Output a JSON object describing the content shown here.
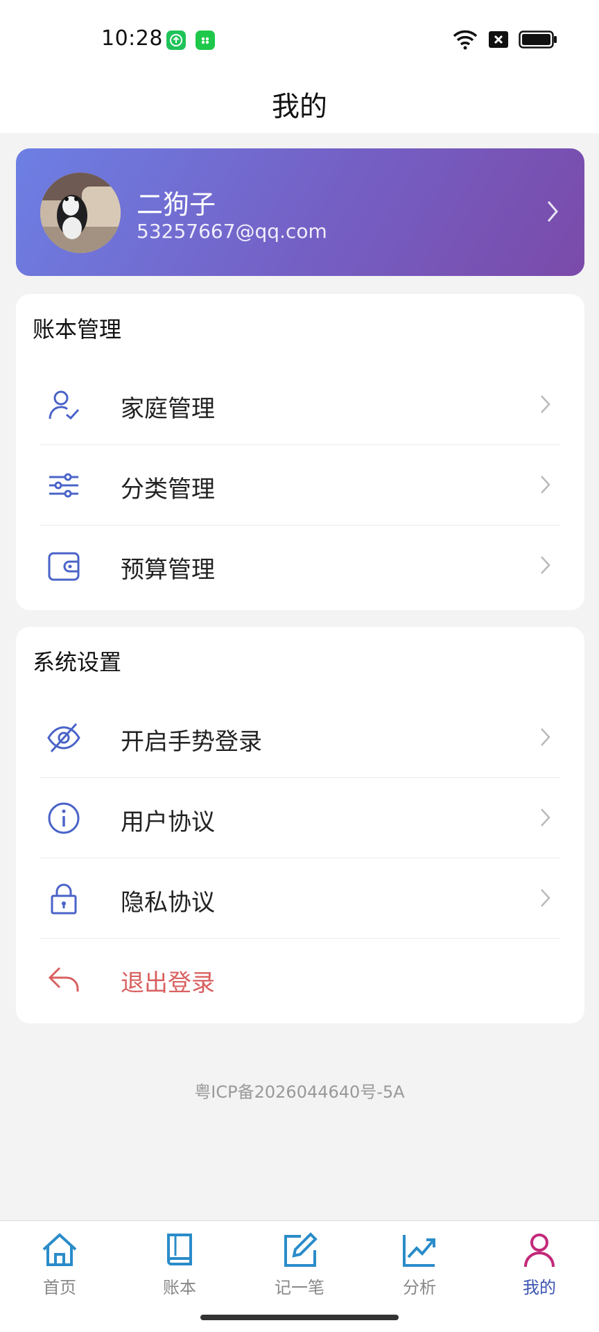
{
  "status_bar": {
    "time": "10:28"
  },
  "header": {
    "title": "我的"
  },
  "profile": {
    "name": "二狗子",
    "email": "53257667@qq.com"
  },
  "sections": [
    {
      "title": "账本管理",
      "items": [
        {
          "label": "家庭管理",
          "icon": "user-check-icon"
        },
        {
          "label": "分类管理",
          "icon": "sliders-icon"
        },
        {
          "label": "预算管理",
          "icon": "wallet-icon"
        }
      ]
    },
    {
      "title": "系统设置",
      "items": [
        {
          "label": "开启手势登录",
          "icon": "eye-off-icon"
        },
        {
          "label": "用户协议",
          "icon": "info-icon"
        },
        {
          "label": "隐私协议",
          "icon": "lock-icon"
        },
        {
          "label": "退出登录",
          "icon": "logout-arrow-icon"
        }
      ]
    }
  ],
  "footer": {
    "icp": "粤ICP备2026044640号-5A"
  },
  "tabbar": {
    "tabs": [
      {
        "label": "首页",
        "icon": "home-icon"
      },
      {
        "label": "账本",
        "icon": "book-icon"
      },
      {
        "label": "记一笔",
        "icon": "edit-icon"
      },
      {
        "label": "分析",
        "icon": "trend-icon"
      },
      {
        "label": "我的",
        "icon": "person-icon"
      }
    ],
    "active": "我的"
  },
  "colors": {
    "accent": "#4a63c8",
    "danger": "#d96060",
    "active_icon": "#c2297a",
    "active_label": "#3a55b0"
  }
}
